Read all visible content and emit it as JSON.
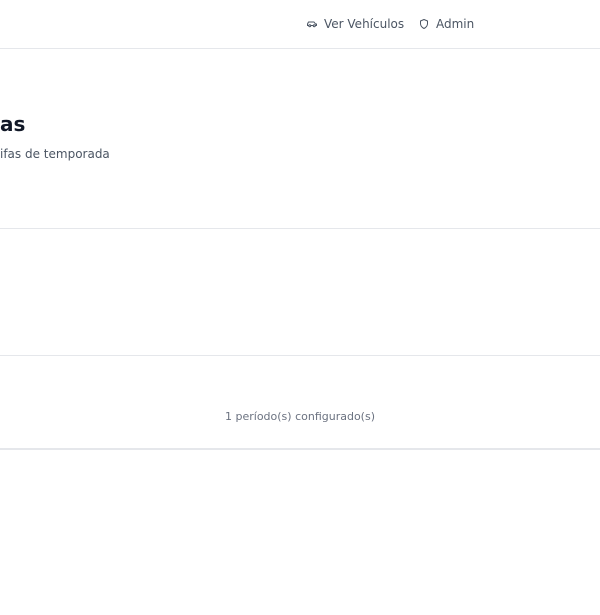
{
  "nav": {
    "vehicles_label": "Ver Vehículos",
    "admin_label": "Admin"
  },
  "header": {
    "title_fragment": "as",
    "subtitle_fragment": "ifas de temporada"
  },
  "summary": {
    "period_count_text": "1 período(s) configurado(s)"
  },
  "icons": {
    "vehicles": "car-icon",
    "admin": "shield-icon"
  },
  "colors": {
    "text_primary": "#111827",
    "text_secondary": "#4b5563",
    "text_muted": "#6b7280",
    "border": "#e5e7eb"
  }
}
